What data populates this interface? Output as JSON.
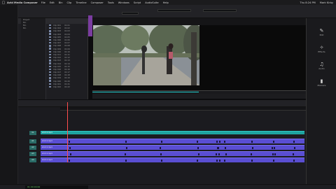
{
  "menubar": {
    "app_name": "Avid Media Composer",
    "items": [
      "File",
      "Edit",
      "Bin",
      "Clip",
      "Timeline",
      "Composer",
      "Tools",
      "Windows",
      "Script",
      "AudioSuite",
      "Help"
    ],
    "right": [
      "Thu 8:24 PM",
      "Mark Kirby"
    ]
  },
  "toolbar": {
    "field1": "",
    "field2": "",
    "field3": ""
  },
  "bin": {
    "project_items": [
      "Project",
      "Bin",
      "Bin",
      "Bin"
    ],
    "rows": [
      {
        "name": "Clip 001",
        "tc": "01:01"
      },
      {
        "name": "Clip 002",
        "tc": "01:02"
      },
      {
        "name": "Clip 003",
        "tc": "01:03"
      },
      {
        "name": "Clip 004",
        "tc": "01:04"
      },
      {
        "name": "Clip 005",
        "tc": "01:05"
      },
      {
        "name": "Clip 006",
        "tc": "01:06"
      },
      {
        "name": "Clip 007",
        "tc": "01:07"
      },
      {
        "name": "Clip 008",
        "tc": "01:08"
      },
      {
        "name": "Clip 009",
        "tc": "01:09"
      },
      {
        "name": "Clip 010",
        "tc": "01:10"
      },
      {
        "name": "Clip 011",
        "tc": "01:11"
      },
      {
        "name": "Clip 012",
        "tc": "01:12"
      },
      {
        "name": "Clip 013",
        "tc": "01:13"
      },
      {
        "name": "Clip 014",
        "tc": "01:14"
      },
      {
        "name": "Clip 015",
        "tc": "01:15"
      },
      {
        "name": "Clip 016",
        "tc": "01:16"
      },
      {
        "name": "Clip 017",
        "tc": "01:17"
      },
      {
        "name": "Clip 018",
        "tc": "01:18"
      },
      {
        "name": "Clip 019",
        "tc": "01:19"
      },
      {
        "name": "Clip 020",
        "tc": "01:20"
      },
      {
        "name": "Clip 021",
        "tc": "01:21"
      },
      {
        "name": "Clip 022",
        "tc": "01:22"
      }
    ]
  },
  "right_panel": {
    "items": [
      "Edit",
      "Effects",
      "Audio",
      "Markers"
    ]
  },
  "timeline": {
    "tracks": [
      {
        "label": "V1",
        "name": "shot 4.mp4"
      },
      {
        "label": "A1",
        "name": "shot 4.mp4"
      },
      {
        "label": "A2",
        "name": "shot 4.mp4"
      },
      {
        "label": "A3",
        "name": "shot 4.mp4"
      },
      {
        "label": "A4",
        "name": "shot 4.mp4"
      }
    ]
  },
  "status": {
    "timecode": "01:00:00:00"
  },
  "colors": {
    "accent": "#1fa3a0",
    "audio": "#5a4ed2",
    "tab": "#7a3ca0"
  }
}
